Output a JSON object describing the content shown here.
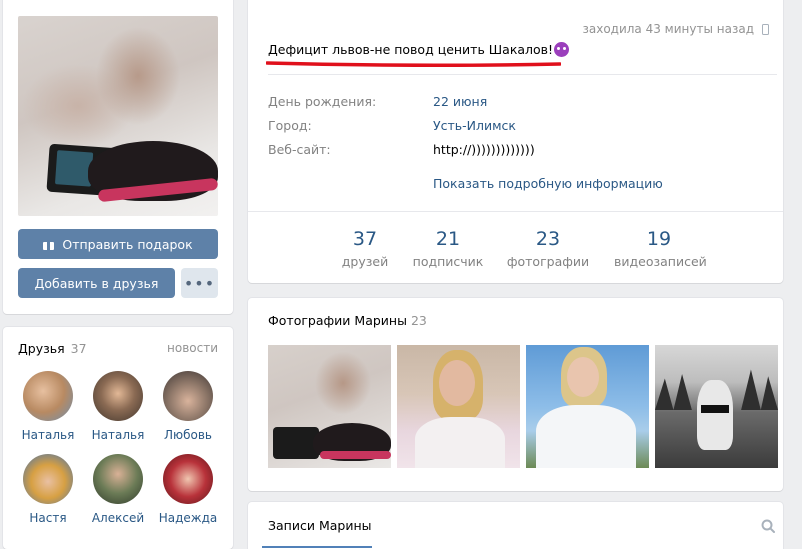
{
  "profile": {
    "last_seen": "заходила 43 минуты назад",
    "status": "Дефицит львов-не повод ценить Шакалов!",
    "info": [
      {
        "label": "День рождения:",
        "value": "22 июня",
        "link": true
      },
      {
        "label": "Город:",
        "value": "Усть-Илимск",
        "link": true
      },
      {
        "label": "Веб-сайт:",
        "value": "http://)))))))))))))",
        "link": false
      }
    ],
    "show_more": "Показать подробную информацию",
    "stats": [
      {
        "num": "37",
        "label": "друзей"
      },
      {
        "num": "21",
        "label": "подписчик"
      },
      {
        "num": "23",
        "label": "фотографии"
      },
      {
        "num": "19",
        "label": "видеозаписей"
      }
    ]
  },
  "actions": {
    "send_gift": "Отправить подарок",
    "add_friend": "Добавить в друзья",
    "more": "•••"
  },
  "friends": {
    "title": "Друзья",
    "count": "37",
    "news": "новости",
    "items": [
      {
        "name": "Наталья",
        "color": "#b88a62"
      },
      {
        "name": "Наталья",
        "color": "#6b5a4c"
      },
      {
        "name": "Любовь",
        "color": "#8a7466"
      },
      {
        "name": "Настя",
        "color": "#d7a043"
      },
      {
        "name": "Алексей",
        "color": "#6b7b56"
      },
      {
        "name": "Надежда",
        "color": "#b8323a"
      }
    ]
  },
  "photos": {
    "title": "Фотографии Марины",
    "count": "23"
  },
  "wall": {
    "tab": "Записи Марины"
  },
  "colors": {
    "accent": "#5e81a8",
    "link": "#2a5885",
    "underline_red": "#e0101c"
  }
}
